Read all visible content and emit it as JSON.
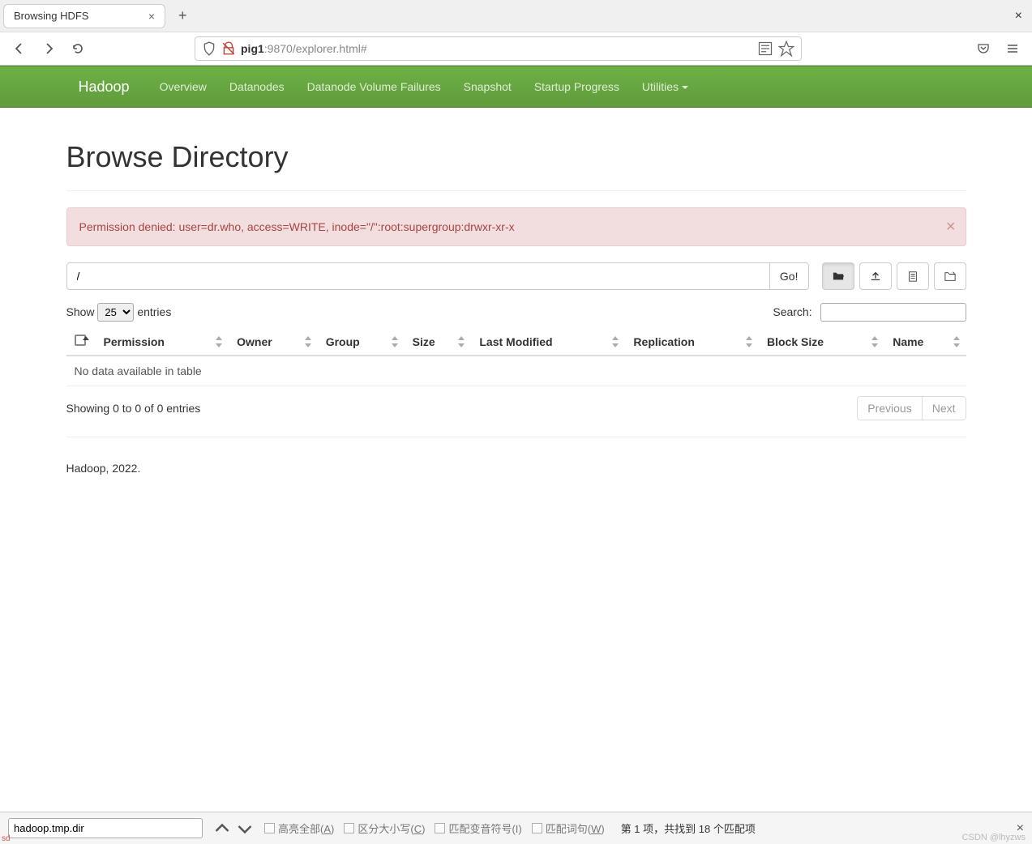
{
  "browser": {
    "tab_title": "Browsing HDFS",
    "url_display_bold": "pig1",
    "url_display_rest": ":9870/explorer.html#"
  },
  "navbar": {
    "brand": "Hadoop",
    "items": [
      "Overview",
      "Datanodes",
      "Datanode Volume Failures",
      "Snapshot",
      "Startup Progress",
      "Utilities"
    ]
  },
  "page": {
    "title": "Browse Directory",
    "alert_text": "Permission denied: user=dr.who, access=WRITE, inode=\"/\":root:supergroup:drwxr-xr-x",
    "path_value": "/",
    "go_label": "Go!",
    "show_label_before": "Show",
    "show_label_after": "entries",
    "show_selected": "25",
    "search_label": "Search:",
    "table_headers": [
      "",
      "Permission",
      "Owner",
      "Group",
      "Size",
      "Last Modified",
      "Replication",
      "Block Size",
      "Name"
    ],
    "empty_text": "No data available in table",
    "info_text": "Showing 0 to 0 of 0 entries",
    "prev_label": "Previous",
    "next_label": "Next",
    "footer_text": "Hadoop, 2022."
  },
  "findbar": {
    "input_value": "hadoop.tmp.dir",
    "opt_highlight": "高亮全部(",
    "opt_highlight_key": "A",
    "opt_case": "区分大小写(",
    "opt_case_key": "C",
    "opt_diac": "匹配变音符号(I)",
    "opt_word": "匹配词句(",
    "opt_word_key": "W",
    "close_paren": ")",
    "status": "第 1 项，共找到 18 个匹配项",
    "watermark": "CSDN @lhyzws",
    "corner": "sd"
  }
}
